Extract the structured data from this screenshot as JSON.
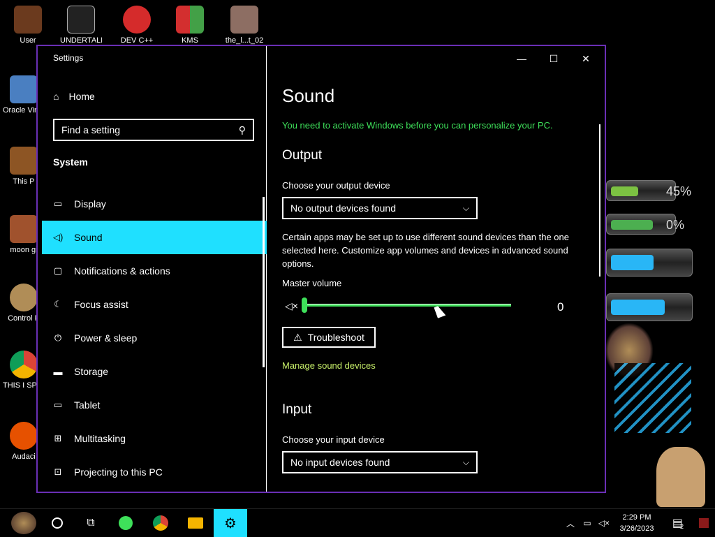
{
  "desktop": {
    "icons": [
      {
        "label": "User",
        "color": "#6b3a1e"
      },
      {
        "label": "UNDERTALE Enhanced",
        "color": "#444444"
      },
      {
        "label": "DEV C++",
        "color": "#d52b2b"
      },
      {
        "label": "KMS",
        "color": "#2e7d32"
      },
      {
        "label": "the_l...t_02",
        "color": "#8d6e63"
      },
      {
        "label": "Oracle VirtualB",
        "color": "#4a7fc1"
      },
      {
        "label": "This P",
        "color": "#8d5524"
      },
      {
        "label": "moon gi",
        "color": "#a0522d"
      },
      {
        "label": "Control P",
        "color": "#b08d57"
      },
      {
        "label": "THIS I SPYWA",
        "color": "#1e88e5"
      },
      {
        "label": "Audaci",
        "color": "#e65100"
      }
    ],
    "gauges": [
      {
        "percent": "45%",
        "fill": 0.45,
        "color": "#7cc242"
      },
      {
        "percent": "0%",
        "fill": 0.7,
        "color": "#4caf50"
      },
      {
        "percent": "",
        "fill": 0.55,
        "color": "#29b6f6"
      },
      {
        "percent": "",
        "fill": 0.7,
        "color": "#29b6f6"
      }
    ]
  },
  "window": {
    "title": "Settings",
    "controls": {
      "minimize": "—",
      "maximize": "☐",
      "close": "✕"
    }
  },
  "nav": {
    "home_label": "Home",
    "search_placeholder": "Find a setting",
    "section_label": "System",
    "items": [
      {
        "label": "Display",
        "icon": "display-icon",
        "glyph": "▭"
      },
      {
        "label": "Sound",
        "icon": "speaker-icon",
        "glyph": "🔊"
      },
      {
        "label": "Notifications & actions",
        "icon": "notification-icon",
        "glyph": "▢"
      },
      {
        "label": "Focus assist",
        "icon": "moon-icon",
        "glyph": "☾"
      },
      {
        "label": "Power & sleep",
        "icon": "power-icon",
        "glyph": "⏻"
      },
      {
        "label": "Storage",
        "icon": "storage-icon",
        "glyph": "▬"
      },
      {
        "label": "Tablet",
        "icon": "tablet-icon",
        "glyph": "▭"
      },
      {
        "label": "Multitasking",
        "icon": "multitasking-icon",
        "glyph": "⊞"
      },
      {
        "label": "Projecting to this PC",
        "icon": "projecting-icon",
        "glyph": "⊡"
      }
    ],
    "active_index": 1
  },
  "content": {
    "title": "Sound",
    "activation_notice": "You need to activate Windows before you can personalize your PC.",
    "output": {
      "heading": "Output",
      "device_label": "Choose your output device",
      "device_value": "No output devices found",
      "description": "Certain apps may be set up to use different sound devices than the one selected here. Customize app volumes and devices in advanced sound options.",
      "volume_label": "Master volume",
      "volume_value": "0",
      "volume_fraction": 0,
      "troubleshoot_label": "Troubleshoot",
      "manage_link": "Manage sound devices"
    },
    "input": {
      "heading": "Input",
      "device_label": "Choose your input device",
      "device_value": "No input devices found"
    }
  },
  "taskbar": {
    "clock_time": "2:29 PM",
    "clock_date": "3/26/2023",
    "notification_count": "2"
  }
}
